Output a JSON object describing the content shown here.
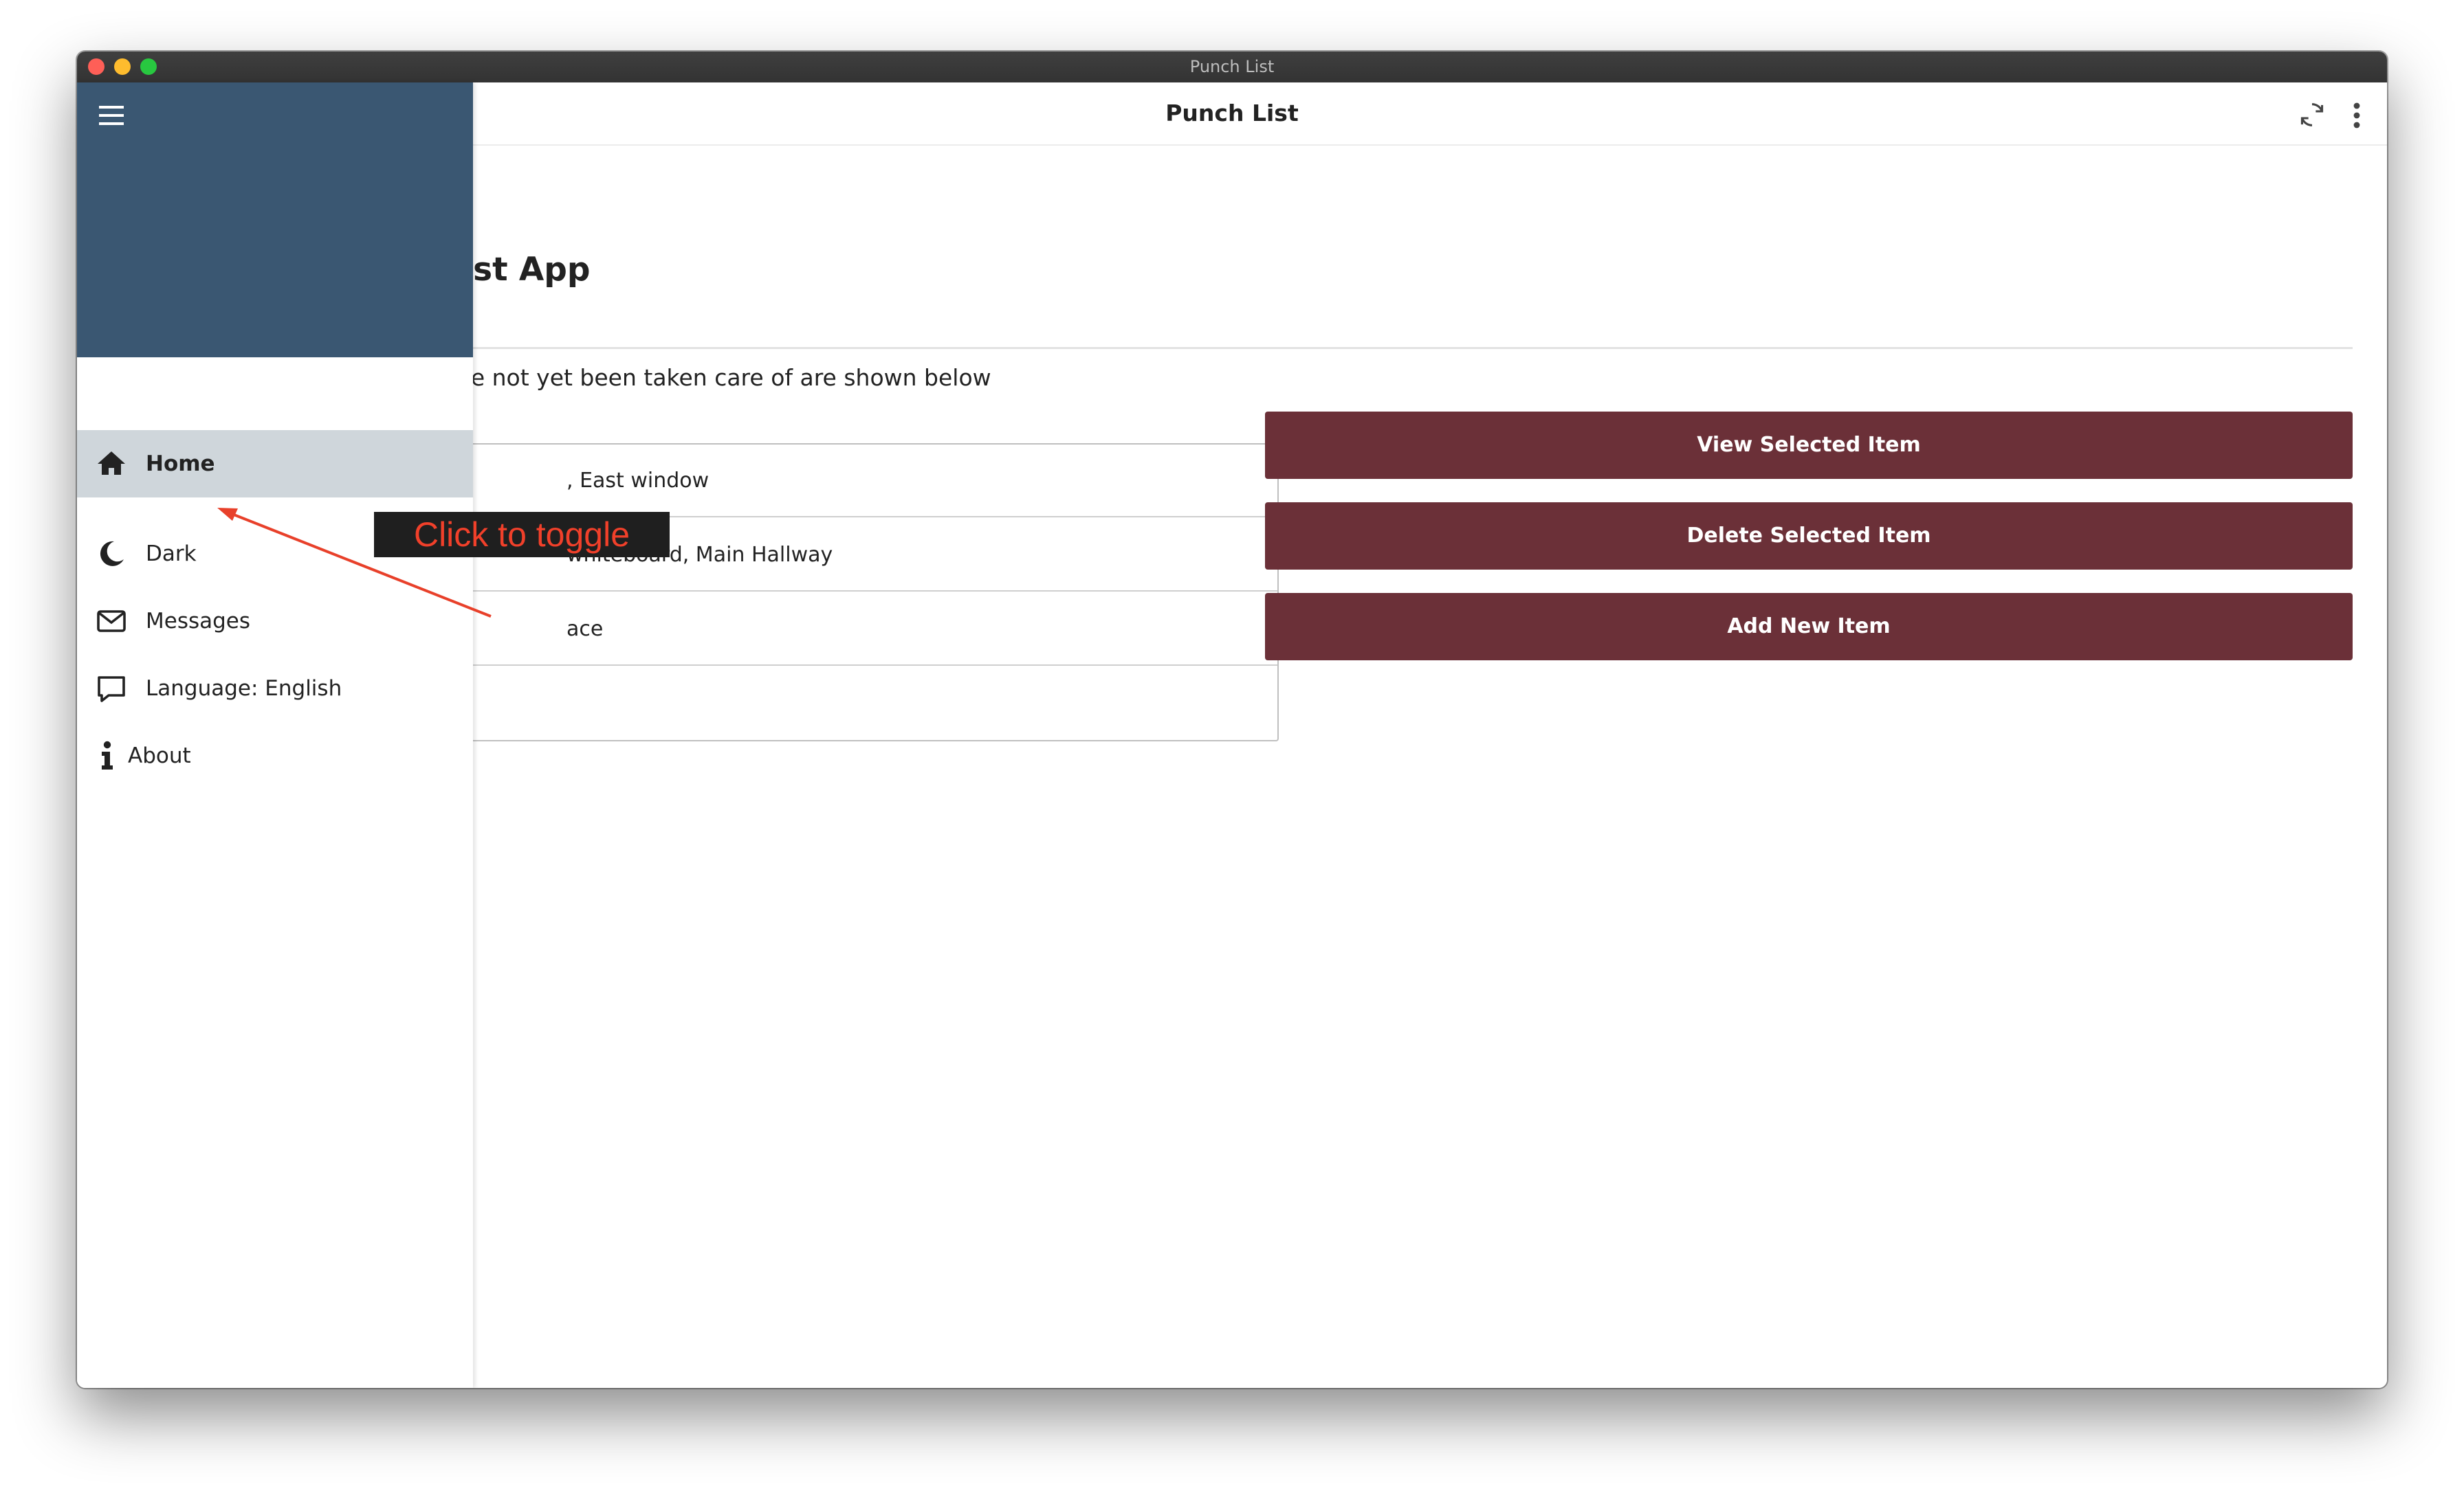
{
  "window": {
    "title": "Punch List"
  },
  "appbar": {
    "title": "Punch List",
    "sync_icon": "sync-icon",
    "more_icon": "more-vert-icon"
  },
  "main": {
    "heading": "ist App",
    "subtitle": "re not yet been taken care of are shown below",
    "list_items": [
      ", East window",
      "whiteboard, Main Hallway",
      "ace",
      ""
    ],
    "buttons": {
      "view": "View Selected Item",
      "delete": "Delete Selected Item",
      "add": "Add New Item"
    }
  },
  "drawer": {
    "items": [
      {
        "label": "Home",
        "icon": "home-icon",
        "active": true
      },
      {
        "label": "Dark",
        "icon": "moon-icon"
      },
      {
        "label": "Messages",
        "icon": "envelope-icon"
      },
      {
        "label": "Language: English",
        "icon": "speech-bubble-icon"
      },
      {
        "label": "About",
        "icon": "info-icon"
      }
    ]
  },
  "annotation": {
    "text": "Click to toggle"
  },
  "colors": {
    "drawer_header": "#3a5772",
    "button": "#6b3038",
    "active_item": "#cfd6db",
    "annotation_text": "#f1402a",
    "annotation_arrow": "#e8402a"
  }
}
